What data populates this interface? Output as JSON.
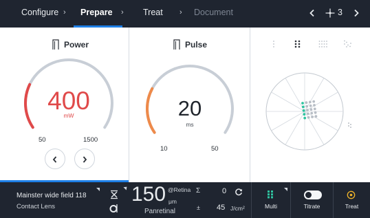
{
  "nav": {
    "crumbs": [
      {
        "label": "Configure",
        "state": "done"
      },
      {
        "label": "Prepare",
        "state": "active"
      },
      {
        "label": "Treat",
        "state": "normal"
      },
      {
        "label": "Document",
        "state": "disabled"
      }
    ],
    "separator": "›",
    "prev_icon": "chevron-left-icon",
    "next_icon": "chevron-right-icon",
    "position_icon": "crosshair-icon",
    "position_value": "3"
  },
  "power": {
    "title": "Power",
    "icon": "power-bracket-icon",
    "value": "400",
    "unit": "mW",
    "min_label": "50",
    "max_label": "1500",
    "min": 50,
    "max": 1500,
    "current": 400,
    "fill_fraction": 0.24,
    "accent_color": "#e04a4a",
    "decrement_icon": "chevron-left-icon",
    "increment_icon": "chevron-right-icon"
  },
  "pulse": {
    "title": "Pulse",
    "icon": "pulse-bracket-icon",
    "value": "20",
    "unit": "ms",
    "min_label": "10",
    "max_label": "50",
    "min": 10,
    "max": 50,
    "current": 20,
    "fill_fraction": 0.25,
    "accent_color": "#ee8a4a"
  },
  "pattern": {
    "tabs": [
      {
        "icon": "single-spot-pattern-icon",
        "selected": false
      },
      {
        "icon": "grid-2x2-pattern-icon",
        "selected": true
      },
      {
        "icon": "grid-3x3-pattern-icon",
        "selected": false
      },
      {
        "icon": "grid-scatter-pattern-icon",
        "selected": false
      }
    ],
    "target_icon": "retina-target-icon",
    "spot_active_color": "#2fc4a0",
    "spot_inactive_color": "#b8bec6"
  },
  "status": {
    "lens_title": "Mainster wide field 118",
    "lens_subtitle": "Contact Lens",
    "spot_icon": "spot-size-icon",
    "ring_icon": "spot-ring-icon",
    "spot_size": "150",
    "spot_ref": "@Retina",
    "spot_unit": "μm",
    "mode_label": "Panretinal",
    "sum_symbol": "Σ",
    "count": "0",
    "reset_icon": "reset-icon",
    "energy_symbol": "±",
    "energy_value": "45",
    "energy_unit": "J/cm²",
    "multi_label": "Multi",
    "multi_icon": "multi-grid-icon",
    "titrate_label": "Titrate",
    "titrate_on": false,
    "treat_label": "Treat",
    "treat_icon": "treat-target-icon",
    "accent_color": "#f0b429",
    "multi_color": "#2fc4a0"
  }
}
